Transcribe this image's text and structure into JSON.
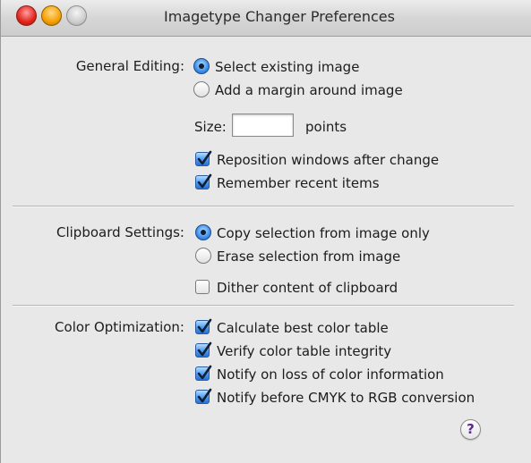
{
  "window": {
    "title": "Imagetype Changer Preferences"
  },
  "general_editing": {
    "label": "General Editing:",
    "radio_select": "Select existing image",
    "radio_margin": "Add a margin around image",
    "selected": "Select existing image",
    "size_label": "Size:",
    "size_value": "",
    "size_unit": "points",
    "check_reposition": "Reposition windows after change",
    "check_reposition_checked": true,
    "check_remember": "Remember recent items",
    "check_remember_checked": true
  },
  "clipboard_settings": {
    "label": "Clipboard Settings:",
    "radio_copy": "Copy selection from image only",
    "radio_erase": "Erase selection from image",
    "selected": "Copy selection from image only",
    "check_dither": "Dither content of clipboard",
    "check_dither_checked": false
  },
  "color_optimization": {
    "label": "Color Optimization:",
    "check_calculate": "Calculate best color table",
    "check_verify": "Verify color table integrity",
    "check_notify_loss": "Notify on loss of color information",
    "check_notify_cmyk": "Notify before CMYK to RGB conversion",
    "all_checked": true
  },
  "help_button": {
    "glyph": "?"
  },
  "colors": {
    "accent": "#3b8ee8",
    "window_bg": "#e8e8e8"
  }
}
